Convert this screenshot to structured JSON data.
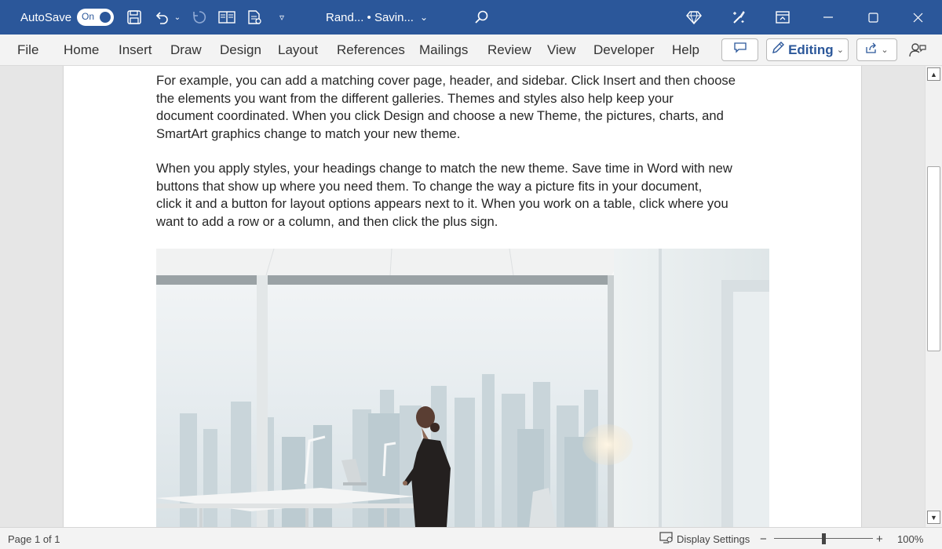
{
  "titlebar": {
    "autosave_label": "AutoSave",
    "autosave_toggle": "On",
    "doc_title": "Rand... • Savin...",
    "icons": [
      "save-icon",
      "undo-icon",
      "redo-icon",
      "layout-icon",
      "compare-icon",
      "customize-icon",
      "search-icon",
      "premium-icon",
      "designer-icon",
      "ribbon-display-icon",
      "minimize-icon",
      "maximize-icon",
      "close-icon"
    ]
  },
  "ribbon": {
    "tabs": [
      "File",
      "Home",
      "Insert",
      "Draw",
      "Design",
      "Layout",
      "References",
      "Mailings",
      "Review",
      "View",
      "Developer",
      "Help"
    ],
    "editing_label": "Editing"
  },
  "document": {
    "paragraphs": [
      [
        "For example, you can add a matching cover page, header, and sidebar. Click Insert and then choose",
        "the elements you want from the different galleries. Themes and styles also help keep your",
        "document coordinated. When you click Design and choose a new Theme, the pictures, charts, and",
        "SmartArt graphics change to match your new theme."
      ],
      [
        "When you apply styles, your headings change to match the new theme. Save time in Word with new",
        "buttons that show up where you need them. To change the way a picture fits in your document,",
        "click it and a button for layout options appears next to it. When you work on a table, click where you",
        "want to add a row or a column, and then click the plus sign."
      ]
    ]
  },
  "statusbar": {
    "page_info": "Page 1 of 1",
    "display_settings": "Display Settings",
    "zoom_minus": "−",
    "zoom_plus": "+",
    "zoom_level": "100%",
    "zoom_fraction": 0.5
  },
  "colors": {
    "accent": "#2b579a",
    "ribbon_bg": "#f3f3f3",
    "page_bg": "#ffffff"
  }
}
